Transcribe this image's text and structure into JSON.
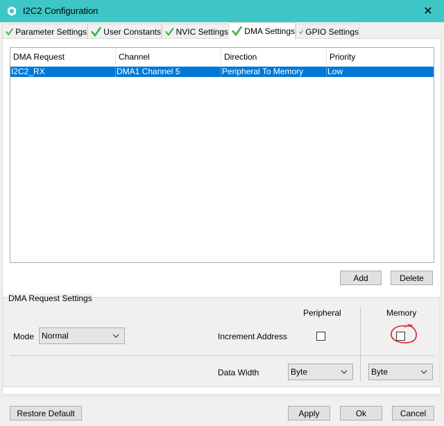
{
  "window": {
    "title": "I2C2 Configuration",
    "close_glyph": "✕",
    "accent_color": "#3ec6c6",
    "app_icon": "cube-icon"
  },
  "tabs": [
    {
      "label": "Parameter Settings",
      "checked": true
    },
    {
      "label": "User Constants",
      "checked": true
    },
    {
      "label": "NVIC Settings",
      "checked": true
    },
    {
      "label": "DMA Settings",
      "checked": true,
      "active": true
    },
    {
      "label": "GPIO Settings",
      "checked": true
    }
  ],
  "dma_table": {
    "columns": [
      "DMA Request",
      "Channel",
      "Direction",
      "Priority"
    ],
    "rows": [
      {
        "request": "I2C2_RX",
        "channel": "DMA1 Channel 5",
        "direction": "Peripheral To Memory",
        "priority": "Low",
        "selected": true
      }
    ],
    "selection_color": "#0078d7"
  },
  "table_buttons": {
    "add": "Add",
    "delete": "Delete"
  },
  "settings": {
    "group_title": "DMA Request Settings",
    "mode_label": "Mode",
    "mode_value": "Normal",
    "peripheral_header": "Peripheral",
    "memory_header": "Memory",
    "increment_label": "Increment Address",
    "peripheral_increment": false,
    "memory_increment": false,
    "data_width_label": "Data Width",
    "peripheral_width": "Byte",
    "memory_width": "Byte",
    "annotation_color": "#e02020"
  },
  "footer": {
    "restore": "Restore Default",
    "apply": "Apply",
    "ok": "Ok",
    "cancel": "Cancel"
  }
}
